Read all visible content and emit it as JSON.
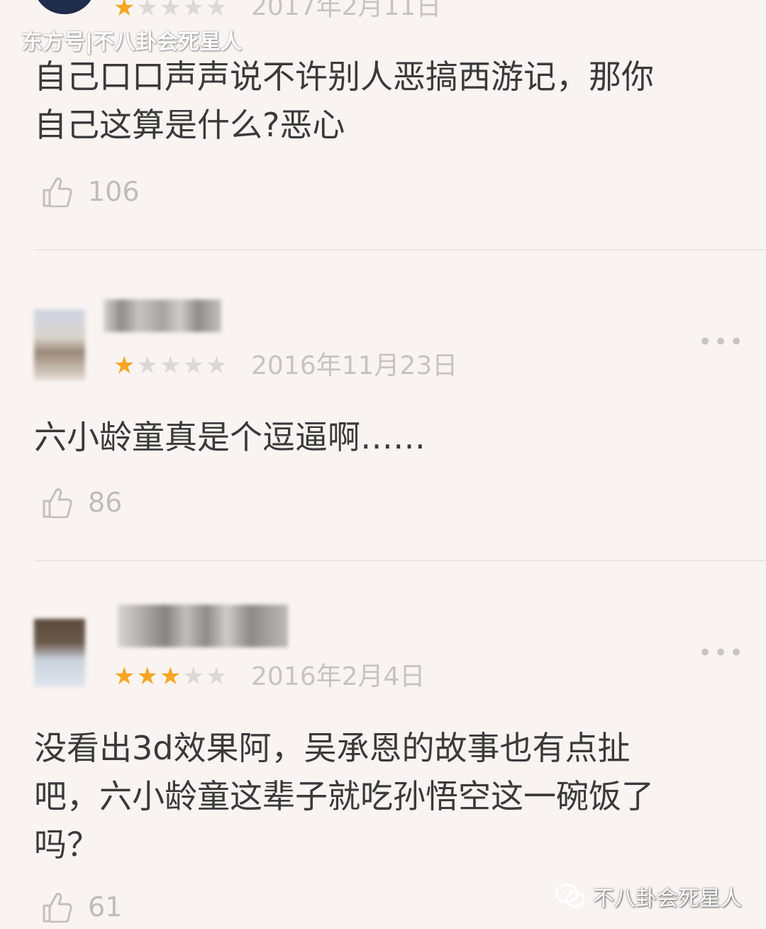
{
  "watermark_top": "东方号|不八卦会死星人",
  "watermark_bottom": "不八卦会死星人",
  "icons": {
    "like": "thumbs-up-icon",
    "more": "more-dots-icon",
    "wechat": "wechat-icon"
  },
  "colors": {
    "star_on": "#f5a623",
    "star_off": "#dcd8d6",
    "background": "#f9f4f1"
  },
  "reviews": [
    {
      "rating": 1,
      "date": "2017年2月11日",
      "text_line1": "自己口口声声说不许别人恶搞西游记，那你",
      "text_line2": "自己这算是什么?恶心",
      "likes": "106"
    },
    {
      "rating": 1,
      "date": "2016年11月23日",
      "text_line1": "六小龄童真是个逗逼啊……",
      "likes": "86",
      "more": "•••"
    },
    {
      "rating": 3,
      "date": "2016年2月4日",
      "text_line1": "没看出3d效果阿，吴承恩的故事也有点扯",
      "text_line2": "吧，六小龄童这辈子就吃孙悟空这一碗饭了",
      "text_line3": "吗？",
      "likes": "61",
      "more": "•••"
    }
  ]
}
